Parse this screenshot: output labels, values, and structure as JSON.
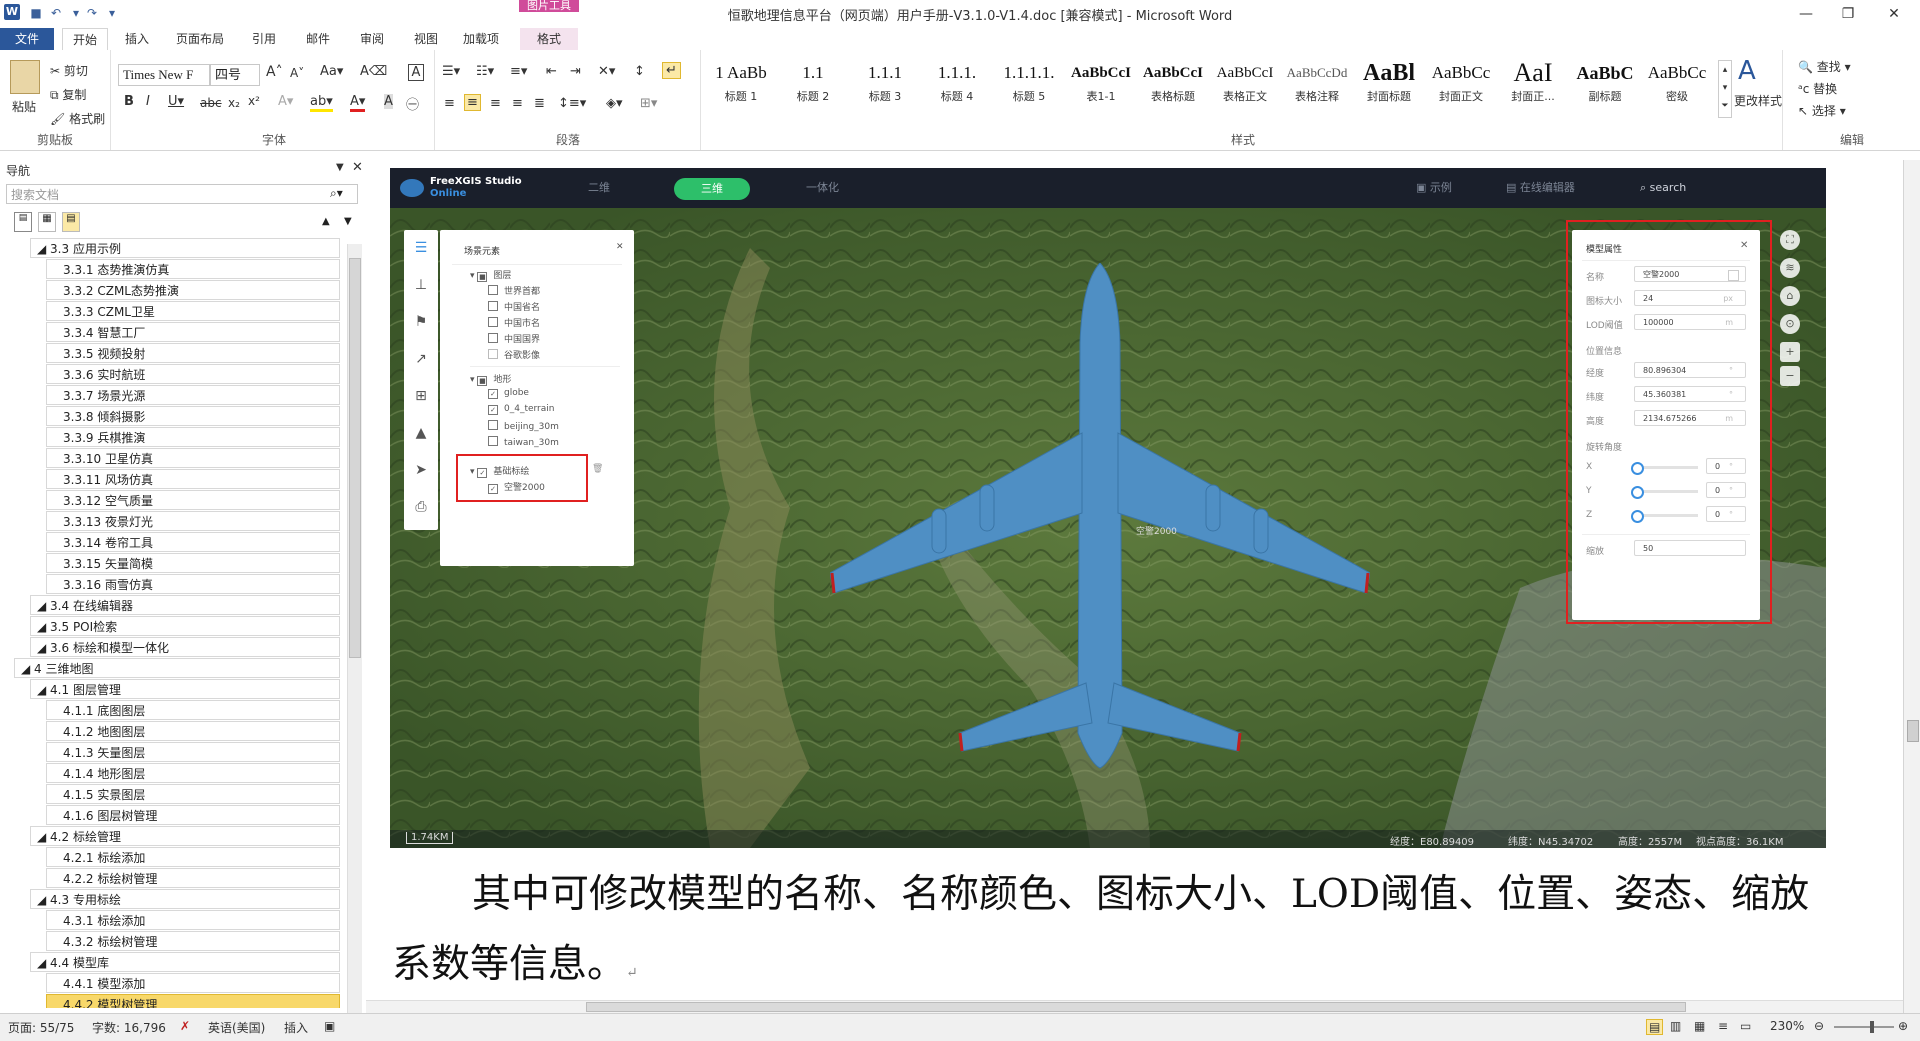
{
  "titlebar": {
    "doc_title": "恒歌地理信息平台（网页端）用户手册-V3.1.0-V1.4.doc [兼容模式] - Microsoft Word",
    "context_header": "图片工具",
    "app_icon": "W"
  },
  "tabs": [
    "文件",
    "开始",
    "插入",
    "页面布局",
    "引用",
    "邮件",
    "审阅",
    "视图",
    "加载项",
    "格式"
  ],
  "ribbon": {
    "clipboard": {
      "paste": "粘贴",
      "cut": "剪切",
      "copy": "复制",
      "format_painter": "格式刷",
      "label": "剪贴板"
    },
    "font": {
      "name": "Times New F",
      "size": "四号",
      "label": "字体"
    },
    "paragraph": {
      "label": "段落"
    },
    "styles": {
      "label": "样式",
      "items": [
        {
          "preview": "1 AaBb",
          "name": "标题 1"
        },
        {
          "preview": "1.1",
          "name": "标题 2"
        },
        {
          "preview": "1.1.1",
          "name": "标题 3"
        },
        {
          "preview": "1.1.1.",
          "name": "标题 4"
        },
        {
          "preview": "1.1.1.1.",
          "name": "标题 5"
        },
        {
          "preview": "AaBbCcI",
          "name": "表1-1"
        },
        {
          "preview": "AaBbCcI",
          "name": "表格标题"
        },
        {
          "preview": "AaBbCcI",
          "name": "表格正文"
        },
        {
          "preview": "AaBbCcDd",
          "name": "表格注释"
        },
        {
          "preview": "AaBl",
          "name": "封面标题"
        },
        {
          "preview": "AaBbCc",
          "name": "封面正文"
        },
        {
          "preview": "AaI",
          "name": "封面正..."
        },
        {
          "preview": "AaBbC",
          "name": "副标题"
        },
        {
          "preview": "AaBbCc",
          "name": "密级"
        }
      ],
      "change": "更改样式"
    },
    "editing": {
      "find": "查找",
      "replace": "替换",
      "select": "选择",
      "label": "编辑"
    }
  },
  "nav": {
    "title": "导航",
    "search_placeholder": "搜索文档",
    "items": [
      {
        "text": "3.3 应用示例",
        "level": 1
      },
      {
        "text": "3.3.1 态势推演仿真",
        "level": 2
      },
      {
        "text": "3.3.2 CZML态势推演",
        "level": 2
      },
      {
        "text": "3.3.3 CZML卫星",
        "level": 2
      },
      {
        "text": "3.3.4 智慧工厂",
        "level": 2
      },
      {
        "text": "3.3.5 视频投射",
        "level": 2
      },
      {
        "text": "3.3.6 实时航班",
        "level": 2
      },
      {
        "text": "3.3.7 场景光源",
        "level": 2
      },
      {
        "text": "3.3.8 倾斜摄影",
        "level": 2
      },
      {
        "text": "3.3.9 兵棋推演",
        "level": 2
      },
      {
        "text": "3.3.10 卫星仿真",
        "level": 2
      },
      {
        "text": "3.3.11 风场仿真",
        "level": 2
      },
      {
        "text": "3.3.12 空气质量",
        "level": 2
      },
      {
        "text": "3.3.13 夜景灯光",
        "level": 2
      },
      {
        "text": "3.3.14 卷帘工具",
        "level": 2
      },
      {
        "text": "3.3.15 矢量简模",
        "level": 2
      },
      {
        "text": "3.3.16 雨雪仿真",
        "level": 2
      },
      {
        "text": "3.4 在线编辑器",
        "level": 1
      },
      {
        "text": "3.5 POI检索",
        "level": 1
      },
      {
        "text": "3.6 标绘和模型一体化",
        "level": 1
      },
      {
        "text": "4 三维地图",
        "level": 0
      },
      {
        "text": "4.1 图层管理",
        "level": 1
      },
      {
        "text": "4.1.1 底图图层",
        "level": 2
      },
      {
        "text": "4.1.2 地图图层",
        "level": 2
      },
      {
        "text": "4.1.3 矢量图层",
        "level": 2
      },
      {
        "text": "4.1.4 地形图层",
        "level": 2
      },
      {
        "text": "4.1.5 实景图层",
        "level": 2
      },
      {
        "text": "4.1.6 图层树管理",
        "level": 2
      },
      {
        "text": "4.2 标绘管理",
        "level": 1
      },
      {
        "text": "4.2.1 标绘添加",
        "level": 2
      },
      {
        "text": "4.2.2 标绘树管理",
        "level": 2
      },
      {
        "text": "4.3 专用标绘",
        "level": 1
      },
      {
        "text": "4.3.1 标绘添加",
        "level": 2
      },
      {
        "text": "4.3.2 标绘树管理",
        "level": 2
      },
      {
        "text": "4.4 模型库",
        "level": 1
      },
      {
        "text": "4.4.1 模型添加",
        "level": 2
      },
      {
        "text": "4.4.2 模型树管理",
        "level": 2,
        "selected": true
      }
    ]
  },
  "map": {
    "brand": "FreeXGIS Studio",
    "brand_sub": "Online",
    "nav": {
      "tab_2d": "二维",
      "tab_3d": "三维",
      "tab_int": "一体化",
      "examples": "示例",
      "editor": "在线编辑器",
      "search": "search"
    },
    "scene_panel": {
      "title": "场景元素",
      "group1": "图层",
      "layers": [
        "世界首都",
        "中国省名",
        "中国市名",
        "中国国界",
        "谷歌影像"
      ],
      "group2": "地形",
      "terrain": [
        "globe",
        "0_4_terrain",
        "beijing_30m",
        "taiwan_30m"
      ],
      "group3": "基础标绘",
      "plot_item": "空警2000"
    },
    "model_panel": {
      "title": "模型属性",
      "name_label": "名称",
      "name_value": "空警2000",
      "icon_label": "图标大小",
      "icon_value": "24",
      "icon_unit": "px",
      "lod_label": "LOD阈值",
      "lod_value": "100000",
      "lod_unit": "m",
      "pos_section": "位置信息",
      "lon_label": "经度",
      "lon_value": "80.896304",
      "lon_unit": "°",
      "lat_label": "纬度",
      "lat_value": "45.360381",
      "lat_unit": "°",
      "alt_label": "高度",
      "alt_value": "2134.675266",
      "alt_unit": "m",
      "rot_section": "旋转角度",
      "x_label": "X",
      "x_value": "0",
      "y_label": "Y",
      "y_value": "0",
      "z_label": "Z",
      "z_value": "0",
      "scale_label": "缩放",
      "scale_value": "50",
      "rot_unit": "°"
    },
    "status": {
      "scale": "1.74KM",
      "lon": "经度：E80.89409",
      "lat": "纬度：N45.34702",
      "alt": "高度：2557M",
      "view_alt": "视点高度：36.1KM"
    },
    "model_label": "空警2000"
  },
  "caption": "其中可修改模型的名称、名称颜色、图标大小、LOD阈值、位置、姿态、缩放系数等信息。",
  "statusbar": {
    "page": "页面: 55/75",
    "words": "字数: 16,796",
    "lang": "英语(美国)",
    "insert": "插入",
    "zoom": "230%"
  }
}
